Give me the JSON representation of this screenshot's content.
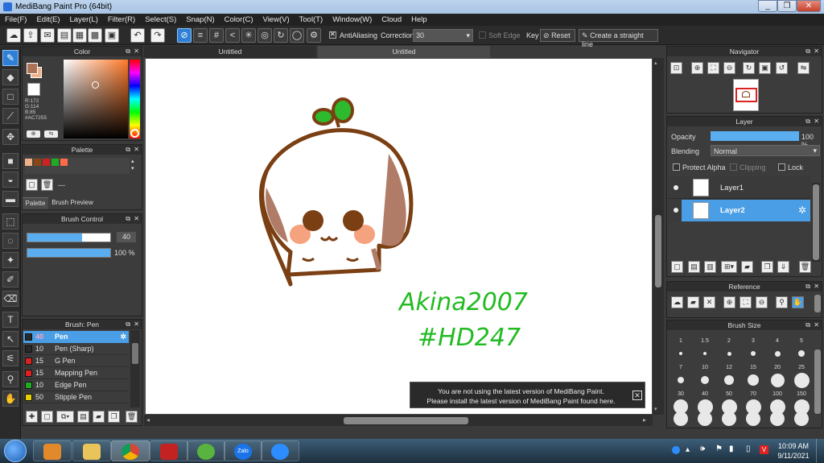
{
  "window": {
    "title": "MediBang Paint Pro (64bit)",
    "minimize": "_",
    "restore": "❐",
    "close": "✕"
  },
  "menu": [
    "File(F)",
    "Edit(E)",
    "Layer(L)",
    "Filter(R)",
    "Select(S)",
    "Snap(N)",
    "Color(C)",
    "View(V)",
    "Tool(T)",
    "Window(W)",
    "Cloud",
    "Help"
  ],
  "toolbar": {
    "antialiasing_label": "AntiAliasing",
    "correction_label": "Correction",
    "correction_value": "30",
    "soft_edge_label": "Soft Edge",
    "key_label": "Key",
    "reset_label": "Reset",
    "straight_line_label": "Create a straight line"
  },
  "tabs": [
    "Untitled",
    "Untitled"
  ],
  "color_panel": {
    "title": "Color",
    "r": "R:172",
    "g": "G:114",
    "b": "B:85",
    "hex": "#AC7255",
    "main_color": "#AC7255",
    "sub_color": "#f0b08a"
  },
  "palette_panel": {
    "title": "Palette",
    "swatches": [
      "#f0b08a",
      "#8b4513",
      "#cc2222",
      "#22aa22",
      "#ff6a4a"
    ],
    "name": "---",
    "tab_palette": "Palette",
    "tab_brush_preview": "Brush Preview"
  },
  "brush_control": {
    "title": "Brush Control",
    "size": "40",
    "size_fraction": 0.66,
    "opacity": "100 %",
    "opacity_fraction": 1.0
  },
  "brush_panel": {
    "title": "Brush: Pen",
    "items": [
      {
        "size": "40",
        "name": "Pen",
        "color": "#2a2a2a",
        "selected": true
      },
      {
        "size": "10",
        "name": "Pen (Sharp)",
        "color": "#2a2a2a"
      },
      {
        "size": "15",
        "name": "G Pen",
        "color": "#dd2222"
      },
      {
        "size": "15",
        "name": "Mapping Pen",
        "color": "#dd2222"
      },
      {
        "size": "10",
        "name": "Edge Pen",
        "color": "#22aa22"
      },
      {
        "size": "50",
        "name": "Stipple Pen",
        "color": "#e8d000"
      }
    ]
  },
  "navigator": {
    "title": "Navigator"
  },
  "layer_panel": {
    "title": "Layer",
    "opacity_label": "Opacity",
    "opacity_value": "100 %",
    "opacity_fraction": 1.0,
    "blending_label": "Blending",
    "blending_value": "Normal",
    "protect_alpha": "Protect Alpha",
    "clipping": "Clipping",
    "lock": "Lock",
    "layers": [
      {
        "name": "Layer1",
        "selected": false
      },
      {
        "name": "Layer2",
        "selected": true
      }
    ]
  },
  "reference_panel": {
    "title": "Reference"
  },
  "brush_size_panel": {
    "title": "Brush Size",
    "sizes": [
      "1",
      "1.5",
      "2",
      "3",
      "4",
      "5",
      "7",
      "10",
      "12",
      "15",
      "20",
      "25",
      "30",
      "40",
      "50",
      "70",
      "100",
      "150"
    ]
  },
  "notification": {
    "line1": "You are not using the latest version of MediBang Paint.",
    "line2": "Please install the latest version of MediBang Paint found here.",
    "close": "✕"
  },
  "artwork": {
    "signature": "Akina2007",
    "tag": "#HD247"
  },
  "taskbar": {
    "time": "10:09 AM",
    "date": "9/11/2021",
    "zalo": "Zalo"
  }
}
